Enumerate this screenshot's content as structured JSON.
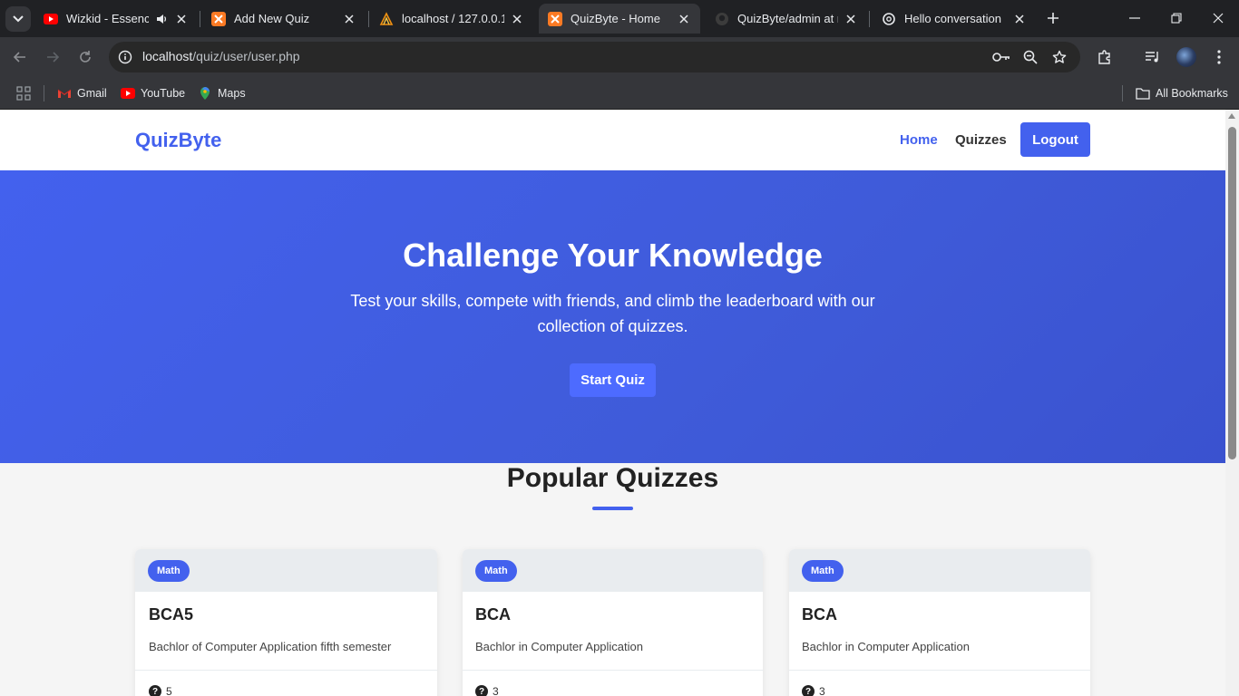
{
  "browser": {
    "tabs": [
      {
        "title": "Wizkid - Essence (",
        "icon": "youtube-icon",
        "audio": true
      },
      {
        "title": "Add New Quiz",
        "icon": "xampp-icon"
      },
      {
        "title": "localhost / 127.0.0.1 / ",
        "icon": "phpmyadmin-icon"
      },
      {
        "title": "QuizByte - Home",
        "icon": "xampp-icon",
        "active": true
      },
      {
        "title": "QuizByte/admin at m",
        "icon": "github-icon"
      },
      {
        "title": "Hello conversation",
        "icon": "chatgpt-icon"
      }
    ],
    "url_host": "localhost",
    "url_path": "/quiz/user/user.php",
    "bookmarks": [
      {
        "label": "Gmail",
        "icon": "gmail-icon"
      },
      {
        "label": "YouTube",
        "icon": "youtube-icon"
      },
      {
        "label": "Maps",
        "icon": "maps-icon"
      }
    ],
    "all_bookmarks": "All Bookmarks"
  },
  "site": {
    "brand": "QuizByte",
    "nav": {
      "home": "Home",
      "quizzes": "Quizzes",
      "logout": "Logout"
    },
    "hero": {
      "title": "Challenge Your Knowledge",
      "subtitle": "Test your skills, compete with friends, and climb the leaderboard with our collection of quizzes.",
      "cta": "Start Quiz"
    },
    "section_title": "Popular Quizzes",
    "quizzes": [
      {
        "category": "Math",
        "title": "BCA5",
        "description": "Bachlor of Computer Application fifth semester",
        "questions": "5"
      },
      {
        "category": "Math",
        "title": "BCA",
        "description": "Bachlor in Computer Application",
        "questions": "3"
      },
      {
        "category": "Math",
        "title": "BCA",
        "description": "Bachlor in Computer Application",
        "questions": "3"
      }
    ]
  },
  "colors": {
    "accent": "#4361ee",
    "chrome_dark": "#202124",
    "chrome_mid": "#35363a"
  }
}
